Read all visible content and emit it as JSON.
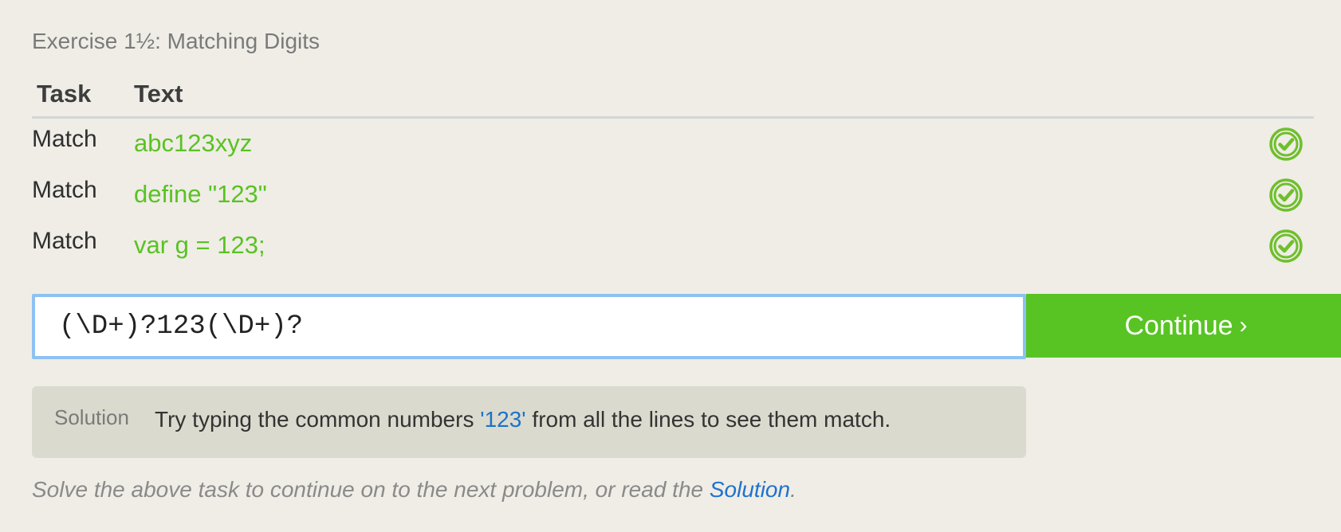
{
  "exercise": {
    "title": "Exercise 1½: Matching Digits"
  },
  "table": {
    "headers": {
      "task": "Task",
      "text": "Text"
    },
    "rows": [
      {
        "task": "Match",
        "text": "abc123xyz",
        "status_icon": "check-circle-icon",
        "status_color": "#6fbf2d"
      },
      {
        "task": "Match",
        "text": "define \"123\"",
        "status_icon": "check-circle-icon",
        "status_color": "#6fbf2d"
      },
      {
        "task": "Match",
        "text": "var g = 123;",
        "status_icon": "check-circle-icon",
        "status_color": "#6fbf2d"
      }
    ]
  },
  "input": {
    "value": "(\\D+)?123(\\D+)?"
  },
  "continue_button": {
    "label": "Continue",
    "arrow": "›"
  },
  "solution": {
    "label": "Solution",
    "text_before": "Try typing the common numbers ",
    "highlight": "'123'",
    "text_after": " from all the lines to see them match."
  },
  "footer": {
    "text_before": "Solve the above task to continue on to the next problem, or read the ",
    "link": "Solution",
    "text_after": "."
  },
  "colors": {
    "background": "#efede6",
    "match_text": "#5ac223",
    "button": "#58c423",
    "input_focus_border": "#8ec1f3",
    "solution_box": "#dbdace",
    "link": "#1f72cf"
  }
}
